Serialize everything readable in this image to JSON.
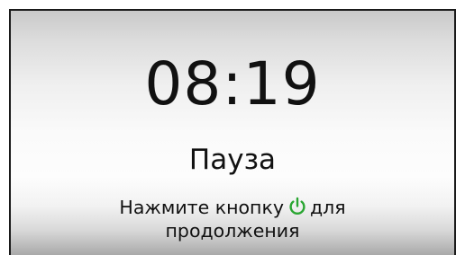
{
  "display": {
    "time": "08:19",
    "status": "Пауза",
    "hint_before_icon": "Нажмите кнопку",
    "hint_after_icon": "для",
    "hint_line2": "продолжения",
    "icon": "power-icon",
    "colors": {
      "text": "#111111",
      "icon": "#2aa632",
      "frame": "#1a1a1a"
    }
  }
}
